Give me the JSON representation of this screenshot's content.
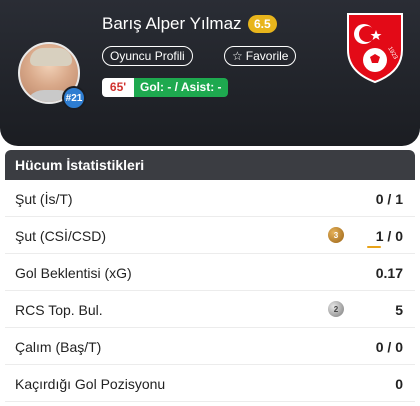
{
  "player": {
    "name": "Barış Alper Yılmaz",
    "rating": "6.5",
    "number": "#21",
    "profile_label": "Oyuncu Profili",
    "favorite_label": "Favorile",
    "minutes": "65'",
    "goals_assists": "Gol: - / Asist: -"
  },
  "colors": {
    "rating": "#e8b51c",
    "goals_bg": "#1ea94f",
    "minutes_text": "#d0312d",
    "crest_red": "#e30a17"
  },
  "stats": {
    "title": "Hücum İstatistikleri",
    "rows": [
      {
        "label": "Şut (İs/T)",
        "value": "0 / 1"
      },
      {
        "label": "Şut (CSİ/CSD)",
        "value": "1 / 0",
        "medal": "3"
      },
      {
        "label": "Gol Beklentisi (xG)",
        "value": "0.17"
      },
      {
        "label": "RCS Top. Bul.",
        "value": "5",
        "medal": "2"
      },
      {
        "label": "Çalım (Baş/T)",
        "value": "0 / 0"
      },
      {
        "label": "Kaçırdığı Gol Pozisyonu",
        "value": "0"
      }
    ]
  },
  "icons": {
    "favorite": "star-outline-icon",
    "crest": "turkey-national-team-crest"
  },
  "crest_text": "1923"
}
